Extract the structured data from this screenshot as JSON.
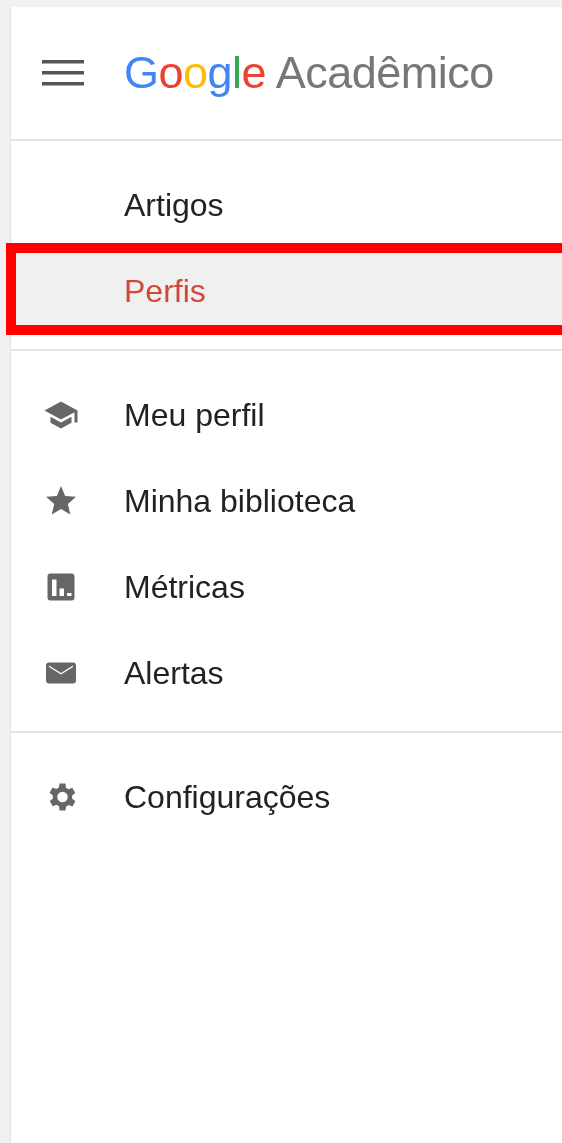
{
  "header": {
    "logo": {
      "brand": "Google",
      "product": "Acadêmico"
    }
  },
  "sections": [
    {
      "items": [
        {
          "label": "Artigos",
          "selected": false,
          "highlighted": false
        },
        {
          "label": "Perfis",
          "selected": true,
          "highlighted": true
        }
      ]
    },
    {
      "items": [
        {
          "label": "Meu perfil",
          "kind": "cap",
          "selected": false,
          "highlighted": false
        },
        {
          "label": "Minha biblioteca",
          "kind": "star",
          "selected": false,
          "highlighted": false
        },
        {
          "label": "Métricas",
          "kind": "chart",
          "selected": false,
          "highlighted": false
        },
        {
          "label": "Alertas",
          "kind": "mail",
          "selected": false,
          "highlighted": false
        }
      ]
    },
    {
      "items": [
        {
          "label": "Configurações",
          "kind": "gear",
          "selected": false,
          "highlighted": false
        }
      ]
    }
  ]
}
